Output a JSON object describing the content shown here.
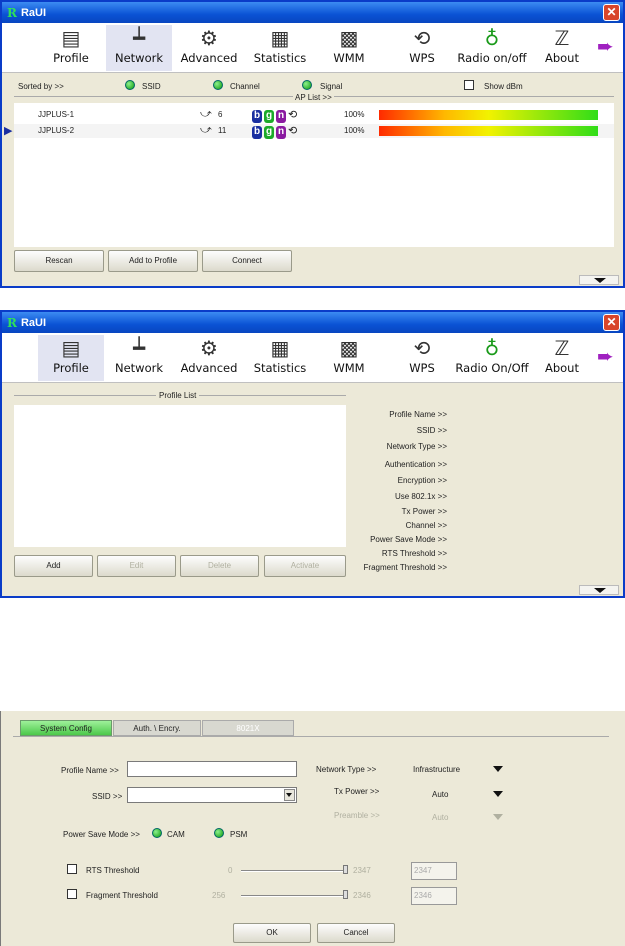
{
  "window": {
    "title": "RaUI",
    "close_glyph": "✕"
  },
  "toolbar": {
    "items": [
      {
        "label": "Profile",
        "icon": "profile-icon"
      },
      {
        "label": "Network",
        "icon": "network-icon"
      },
      {
        "label": "Advanced",
        "icon": "advanced-icon"
      },
      {
        "label": "Statistics",
        "icon": "statistics-icon"
      },
      {
        "label": "WMM",
        "icon": "wmm-icon"
      },
      {
        "label": "WPS",
        "icon": "wps-icon"
      },
      {
        "label": "Radio on/off",
        "icon": "radio-icon"
      },
      {
        "label": "About",
        "icon": "about-icon"
      }
    ],
    "items2": [
      {
        "label": "Profile"
      },
      {
        "label": "Network"
      },
      {
        "label": "Advanced"
      },
      {
        "label": "Statistics"
      },
      {
        "label": "WMM"
      },
      {
        "label": "WPS"
      },
      {
        "label": "Radio On/Off"
      },
      {
        "label": "About"
      }
    ]
  },
  "network": {
    "sorted_by": "Sorted by >>",
    "sort_ssid": "SSID",
    "sort_channel": "Channel",
    "sort_signal": "Signal",
    "show_dbm": "Show dBm",
    "ap_list_label": "AP List >>",
    "rows": [
      {
        "ssid": "JJPLUS-1",
        "channel": "6",
        "signal": "100%",
        "signal_fraction": 1.0,
        "selected": false
      },
      {
        "ssid": "JJPLUS-2",
        "channel": "11",
        "signal": "100%",
        "signal_fraction": 1.0,
        "selected": true
      }
    ],
    "buttons": {
      "rescan": "Rescan",
      "add_to_profile": "Add to Profile",
      "connect": "Connect"
    }
  },
  "profile": {
    "list_title": "Profile List",
    "fields": [
      "Profile Name >>",
      "SSID >>",
      "Network Type >>",
      "Authentication >>",
      "Encryption >>",
      "Use 802.1x >>",
      "Tx Power >>",
      "Channel >>",
      "Power Save Mode >>",
      "RTS Threshold >>",
      "Fragment Threshold >>"
    ],
    "buttons": {
      "add": "Add",
      "edit": "Edit",
      "delete": "Delete",
      "activate": "Activate"
    }
  },
  "config": {
    "tabs": {
      "system": "System Config",
      "auth": "Auth. \\ Encry.",
      "x8021": "8021X"
    },
    "profile_name_label": "Profile Name >>",
    "profile_name_value": "",
    "ssid_label": "SSID >>",
    "ssid_value": "",
    "network_type_label": "Network Type >>",
    "network_type_value": "Infrastructure",
    "tx_power_label": "Tx Power >>",
    "tx_power_value": "Auto",
    "preamble_label": "Preamble >>",
    "preamble_value": "Auto",
    "power_save_label": "Power Save Mode >>",
    "cam_label": "CAM",
    "psm_label": "PSM",
    "rts_label": "RTS Threshold",
    "rts_min": "0",
    "rts_max": "2347",
    "rts_value": "2347",
    "frag_label": "Fragment Threshold",
    "frag_min": "256",
    "frag_max": "2346",
    "frag_value": "2346",
    "ok": "OK",
    "cancel": "Cancel"
  }
}
